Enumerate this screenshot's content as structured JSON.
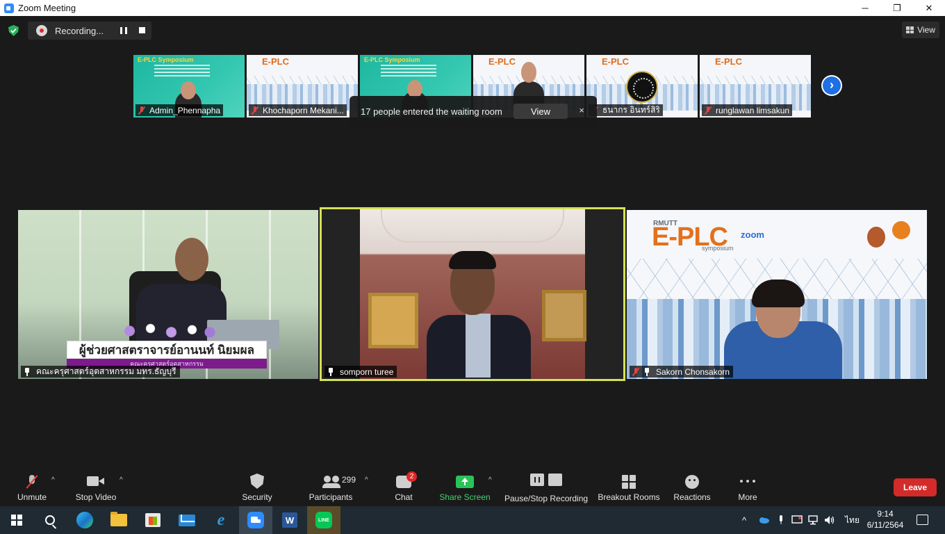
{
  "window": {
    "title": "Zoom Meeting",
    "minimize": "─",
    "maximize": "❐",
    "close": "✕"
  },
  "recording": {
    "label": "Recording..."
  },
  "view_button": {
    "label": "View"
  },
  "thumbnails": [
    {
      "name": "Admin_Phennapha",
      "muted": true,
      "header": "E-PLC Symposium"
    },
    {
      "name": "Khochaporn Mekani...",
      "muted": true,
      "header": "E-PLC"
    },
    {
      "name": "",
      "muted": false,
      "header": "E-PLC Symposium"
    },
    {
      "name": "",
      "muted": false,
      "header": "E-PLC"
    },
    {
      "name": "ธนากร อินทร์สิริ",
      "muted": true,
      "header": "E-PLC"
    },
    {
      "name": "runglawan limsakun",
      "muted": true,
      "header": "E-PLC"
    }
  ],
  "notification": {
    "text": "17 people entered the waiting room",
    "action": "View",
    "close": "×"
  },
  "next_page": "›",
  "tiles": {
    "left": {
      "name": "คณะครุศาสตร์อุตสาหกรรม มทร.ธัญบุรี",
      "banner": "ผู้ช่วยศาสตราจารย์อานนท์ นิยมผล",
      "banner_sub": "คณะครุศาสตร์อุตสาหกรรม"
    },
    "center": {
      "name": "somporn turee",
      "active_speaker": true
    },
    "right": {
      "name": "Sakorn  Chonsakorn",
      "muted": true,
      "logo_top": "RMUTT",
      "logo": "E-PLC",
      "logo_zoom": "zoom",
      "logo_sub": "symposium"
    }
  },
  "toolbar": {
    "unmute": "Unmute",
    "stop_video": "Stop Video",
    "security": "Security",
    "participants": "Participants",
    "participants_count": "299",
    "chat": "Chat",
    "chat_badge": "2",
    "share_screen": "Share Screen",
    "pause_stop_recording": "Pause/Stop Recording",
    "breakout_rooms": "Breakout Rooms",
    "reactions": "Reactions",
    "more": "More",
    "leave": "Leave",
    "caret": "^"
  },
  "taskbar": {
    "apps": [
      "start-icon",
      "search-icon",
      "edge-icon",
      "file-explorer-icon",
      "store-icon",
      "mail-icon",
      "ie-icon",
      "zoom-icon",
      "word-icon",
      "line-icon"
    ],
    "line_label": "LINE",
    "word_label": "W",
    "ie_label": "e",
    "language": "ไทย",
    "time": "9:14",
    "date": "6/11/2564",
    "chevron": "^"
  },
  "colors": {
    "active_speaker_border": "#d4e157",
    "leave_button": "#d32a2a",
    "share_screen": "#48d06d",
    "accent_blue": "#2d8cff"
  }
}
